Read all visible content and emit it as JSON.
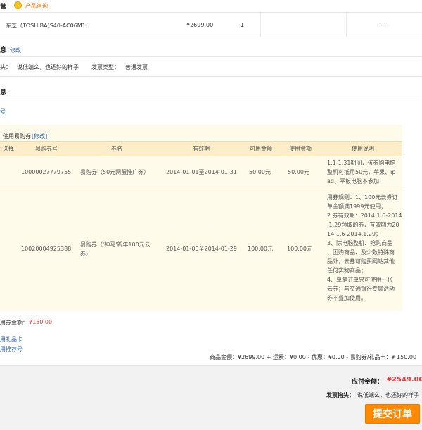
{
  "header": {
    "section_char": "营",
    "consult_label": "产品咨询"
  },
  "product_row": {
    "name": "东芝（TOSHIBA)S40-AC06M1",
    "price": "¥2699.00",
    "qty": "1",
    "dash": "----"
  },
  "invoice": {
    "section_char": "息",
    "edit_label": "修改",
    "title_label": "头：",
    "title_value": "说低端么，也还好的样子",
    "type_label": "发票类型：",
    "type_value": "普通发票"
  },
  "coupons_section": {
    "section_char": "息",
    "link_char": "号",
    "use_label": "使用易购券",
    "edit_label": "[修改]",
    "columns": [
      "选择",
      "易购券号",
      "券名",
      "有效期",
      "可用金额",
      "使用金额",
      "使用说明"
    ],
    "rows": [
      {
        "code": "10000027779755",
        "name": "易购券（50元网盟推广券）",
        "validity": "2014-01-01至2014-01-31",
        "available": "50.00元",
        "used": "50.00元",
        "desc_lines": [
          "1.1-1.31期间，该券购电脑",
          "整机可抵用50元，苹果、ip",
          "ad、平板电脑不参加"
        ]
      },
      {
        "code": "10020004925388",
        "name_lines": [
          "易购券（'神马'新年100元云",
          "券）"
        ],
        "validity": "2014-01-06至2014-01-29",
        "available": "100.00元",
        "used": "100.00元",
        "desc_lines": [
          "用券规则：1、100元云券订",
          "单金额满1999元使用；",
          "2.券有效期：2014.1.6-2014",
          ".1.29领取的券，有效期为20",
          "14.1.6-2014.1.29；",
          "3、除电脑整机、抢购商品",
          "、团购商品、及少数特殊商",
          "品外，云券可购买网站其他",
          "任何实物商品；",
          "4、单笔订单只可使用一张",
          "云券；与交通银行专属活动",
          "券不叠加使用。"
        ]
      }
    ],
    "total_label": "用券金额：",
    "total_value": "¥150.00",
    "gift_card_link": "用礼品卡",
    "recommend_link": "用推荐号"
  },
  "summary": {
    "text": "商品金额：¥2699.00 + 运费：¥0.00 - 优惠：¥0.00 - 易购券/礼品卡：¥ 150.00"
  },
  "bottom": {
    "pay_label": "应付金额：",
    "pay_value": "¥2549.00",
    "invoice_label": "发票抬头：",
    "invoice_value": "说低端么，也还好的样子",
    "submit_label": "提交订单"
  },
  "colors": {
    "accent_orange": "#ff8a00",
    "price_red": "#e4393c",
    "link_blue": "#2f63b3",
    "coupon_bg": "#fffbea"
  }
}
